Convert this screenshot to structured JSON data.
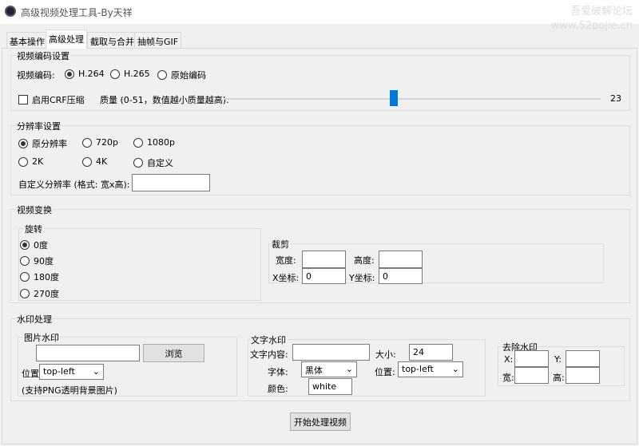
{
  "window": {
    "title": "高级视频处理工具-By天祥",
    "watermark_line1": "吾爱破解论坛",
    "watermark_line2": "www.52pojie.cn"
  },
  "tabs": [
    {
      "label": "基本操作"
    },
    {
      "label": "高级处理",
      "active": true
    },
    {
      "label": "截取与合并"
    },
    {
      "label": "抽帧与GIF"
    }
  ],
  "encoding": {
    "title": "视频编码设置",
    "codec_label": "视频编码:",
    "options": [
      "H.264",
      "H.265",
      "原始编码"
    ],
    "selected": "H.264",
    "crf_label": "启用CRF压缩",
    "crf_checked": false,
    "quality_label": "质量 (0-51，数值越小质量越高):",
    "quality_value": "23",
    "quality_min": 0,
    "quality_max": 51
  },
  "resolution": {
    "title": "分辨率设置",
    "options": [
      "原分辨率",
      "720p",
      "1080p",
      "2K",
      "4K",
      "自定义"
    ],
    "selected": "原分辨率",
    "custom_label": "自定义分辨率 (格式: 宽x高):",
    "custom_value": ""
  },
  "transform": {
    "title": "视频变换",
    "rotate": {
      "title": "旋转",
      "options": [
        "0度",
        "90度",
        "180度",
        "270度"
      ],
      "selected": "0度"
    },
    "crop": {
      "title": "裁剪",
      "width_label": "宽度:",
      "height_label": "高度:",
      "x_label": "X坐标:",
      "y_label": "Y坐标:",
      "width": "",
      "height": "",
      "x": "0",
      "y": "0"
    }
  },
  "watermark": {
    "title": "水印处理",
    "image": {
      "title": "图片水印",
      "path": "",
      "browse_label": "浏览",
      "position_label": "位置:",
      "position": "top-left",
      "hint": "(支持PNG透明背景图片)"
    },
    "text": {
      "title": "文字水印",
      "content_label": "文字内容:",
      "content": "",
      "size_label": "大小:",
      "size": "24",
      "font_label": "字体:",
      "font": "黑体",
      "position_label": "位置:",
      "position": "top-left",
      "color_label": "颜色:",
      "color": "white"
    },
    "remove": {
      "title": "去除水印",
      "x_label": "X:",
      "y_label": "Y:",
      "w_label": "宽:",
      "h_label": "高:",
      "x": "",
      "y": "",
      "w": "",
      "h": ""
    }
  },
  "start_button": "开始处理视频",
  "colors": {
    "accent": "#0078d7"
  }
}
